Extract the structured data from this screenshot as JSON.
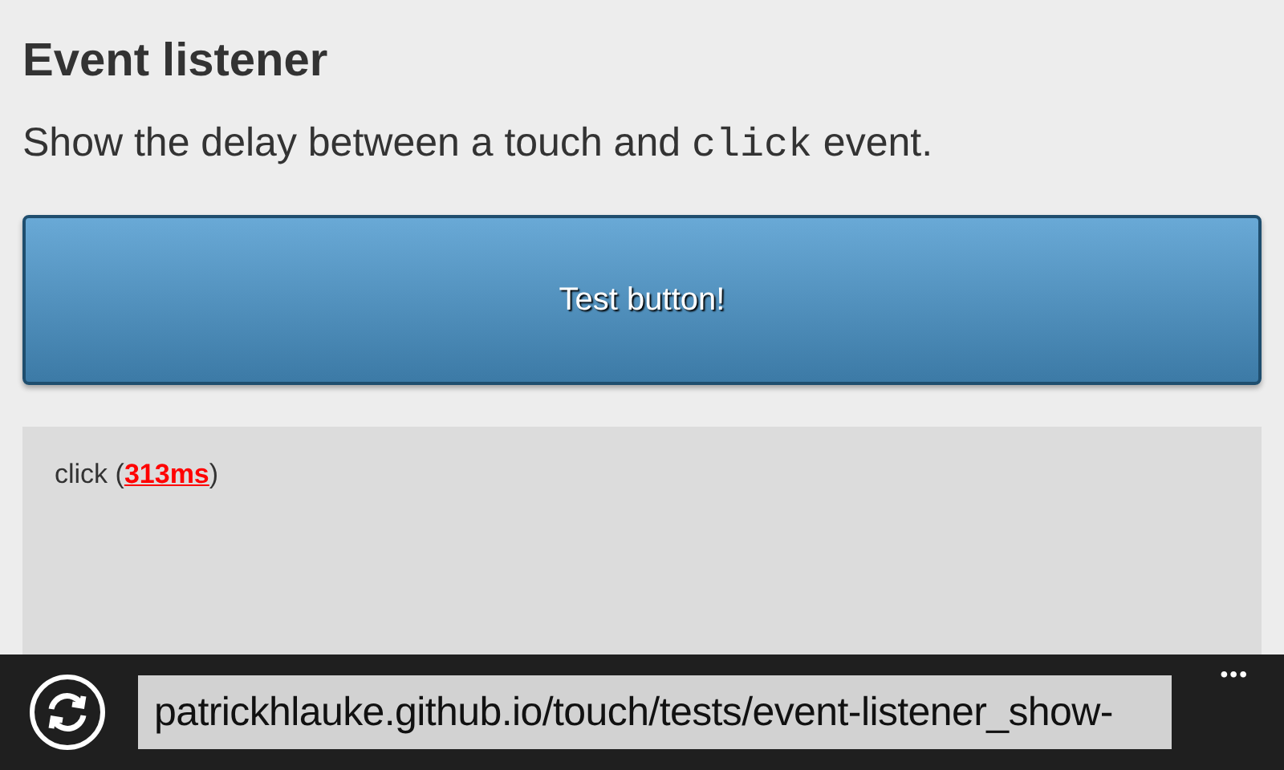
{
  "heading": "Event listener",
  "description": [
    {
      "kind": "text",
      "text": "Show the delay between a touch and "
    },
    {
      "kind": "code",
      "text": "click"
    },
    {
      "kind": "text",
      "text": " event."
    }
  ],
  "button": {
    "label": "Test button!"
  },
  "log": [
    "click (**313ms**)"
  ],
  "address_bar": {
    "url": "patrickhlauke.github.io/touch/tests/event-listener_show-",
    "more": "•••"
  }
}
